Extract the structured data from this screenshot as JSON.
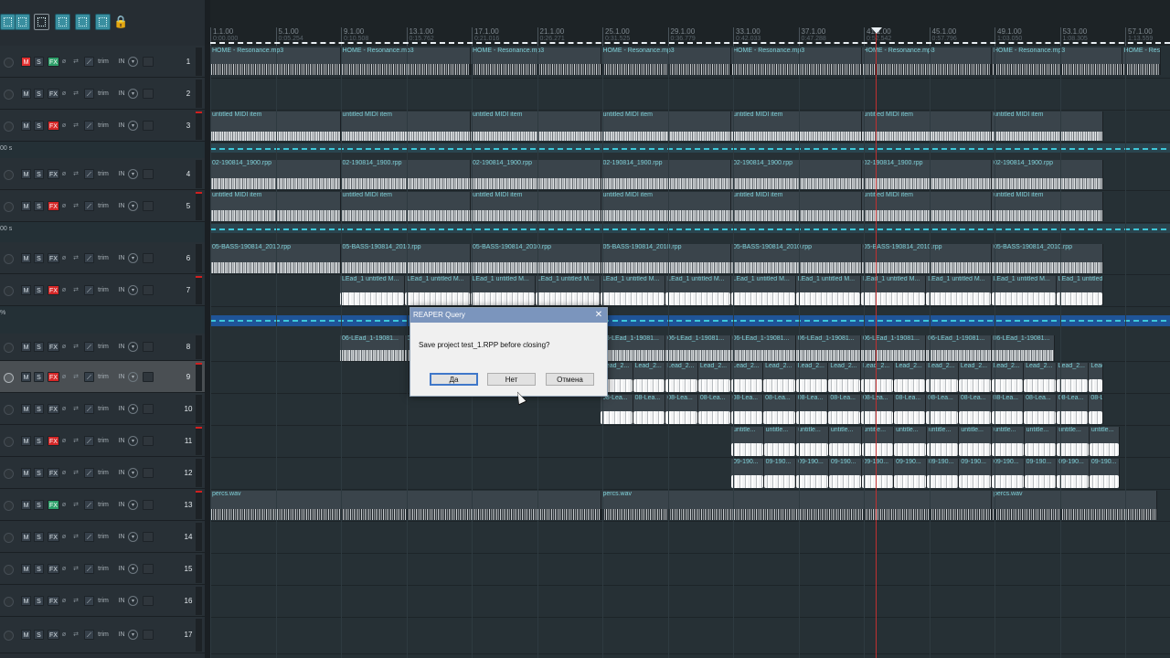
{
  "toolbar": {
    "buttons": [
      "grid-snap",
      "grid-lines",
      "ripple-edit",
      "item-grouping",
      "auto-crossfade",
      "loop-toggle",
      "lock-toggle"
    ],
    "lock_label": "🔒"
  },
  "ruler": {
    "bars": [
      {
        "label": "1.1.00",
        "sub": "0:00.000"
      },
      {
        "label": "5.1.00",
        "sub": "0:05.254"
      },
      {
        "label": "9.1.00",
        "sub": "0:10.508"
      },
      {
        "label": "13.1.00",
        "sub": "0:15.762"
      },
      {
        "label": "17.1.00",
        "sub": "0:21.016"
      },
      {
        "label": "21.1.00",
        "sub": "0:26.271"
      },
      {
        "label": "25.1.00",
        "sub": "0:31.525"
      },
      {
        "label": "29.1.00",
        "sub": "0:36.779"
      },
      {
        "label": "33.1.00",
        "sub": "0:42.033"
      },
      {
        "label": "37.1.00",
        "sub": "0:47.288"
      },
      {
        "label": "41.1.00",
        "sub": "0:52.542"
      },
      {
        "label": "45.1.00",
        "sub": "0:57.796"
      },
      {
        "label": "49.1.00",
        "sub": "1:03.050"
      },
      {
        "label": "53.1.00",
        "sub": "1:08.305"
      },
      {
        "label": "57.1.00",
        "sub": "1:13.559"
      }
    ]
  },
  "track_labels": {
    "m": "M",
    "s": "S",
    "fx": "FX",
    "phase": "ø",
    "route": "⇄",
    "env": "⟋",
    "trim": "trim",
    "in": "IN",
    "arrow": "▾"
  },
  "tracks": [
    {
      "num": "1",
      "mute": true,
      "fx": "green"
    },
    {
      "num": "2",
      "mute": false,
      "fx": "normal"
    },
    {
      "num": "3",
      "mute": false,
      "fx": "red"
    },
    {
      "num": "4",
      "mute": false,
      "fx": "normal"
    },
    {
      "num": "5",
      "mute": false,
      "fx": "red"
    },
    {
      "num": "6",
      "mute": false,
      "fx": "normal"
    },
    {
      "num": "7",
      "mute": false,
      "fx": "red"
    },
    {
      "num": "8",
      "mute": false,
      "fx": "normal"
    },
    {
      "num": "9",
      "mute": false,
      "fx": "red"
    },
    {
      "num": "10",
      "mute": false,
      "fx": "normal"
    },
    {
      "num": "11",
      "mute": false,
      "fx": "red"
    },
    {
      "num": "12",
      "mute": false,
      "fx": "normal"
    },
    {
      "num": "13",
      "mute": false,
      "fx": "green"
    },
    {
      "num": "14",
      "mute": false,
      "fx": "normal"
    },
    {
      "num": "15",
      "mute": false,
      "fx": "normal"
    },
    {
      "num": "16",
      "mute": false,
      "fx": "normal"
    },
    {
      "num": "17",
      "mute": false,
      "fx": "normal"
    }
  ],
  "env_lanes": [
    "00 s",
    "00 s",
    "%"
  ],
  "items": {
    "t1": "HOME - Resonance.mp3",
    "t3": "untitled MIDI item",
    "t4": "02-190814_1900.rpp",
    "t5": "untitled MIDI item",
    "t6": "05-BASS-190814_2010.rpp",
    "t7a": "LEad_1 untitled M...",
    "t7b": "LEad_1 untitled ...",
    "t8": "06-LEad_1-19081...",
    "t9": "Lead_2...",
    "t10": "08-Lea...",
    "t11": "untitle...",
    "t12": "09-190...",
    "t13": "percs.wav"
  },
  "dialog": {
    "title": "REAPER Query",
    "close": "✕",
    "message": "Save project test_1.RPP before closing?",
    "yes": "Да",
    "no": "Нет",
    "cancel": "Отмена"
  }
}
